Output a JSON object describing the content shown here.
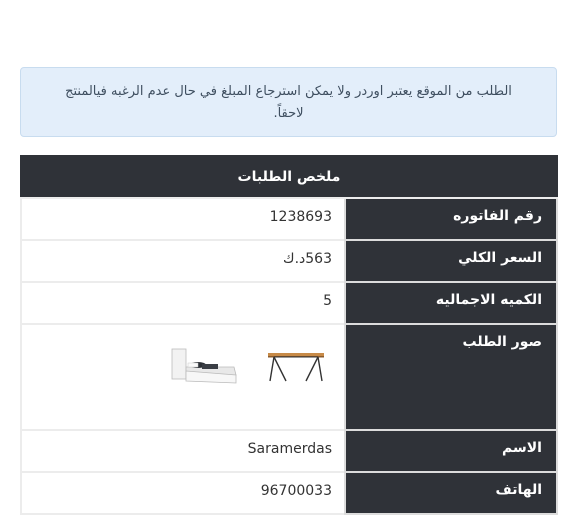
{
  "notice": {
    "text": "الطلب من الموقع يعتبر اوردر ولا يمكن استرجاع المبلغ في حال عدم الرغبه فيالمنتج لاحقاً."
  },
  "summary": {
    "title": "ملخص الطلبات",
    "rows": [
      {
        "label": "رقم الفاتوره",
        "value": "1238693"
      },
      {
        "label": "السعر الكلي",
        "value": "563د.ك"
      },
      {
        "label": "الكميه الاجماليه",
        "value": "5"
      },
      {
        "label": "صور الطلب",
        "images": [
          "table-image",
          "bed-image"
        ]
      },
      {
        "label": "الاسم",
        "value": "Saramerdas"
      },
      {
        "label": "الهاتف",
        "value": "96700033"
      }
    ]
  },
  "colors": {
    "header_bg": "#2f3238",
    "notice_bg": "#e3eefa",
    "notice_text": "#3f4f60"
  }
}
